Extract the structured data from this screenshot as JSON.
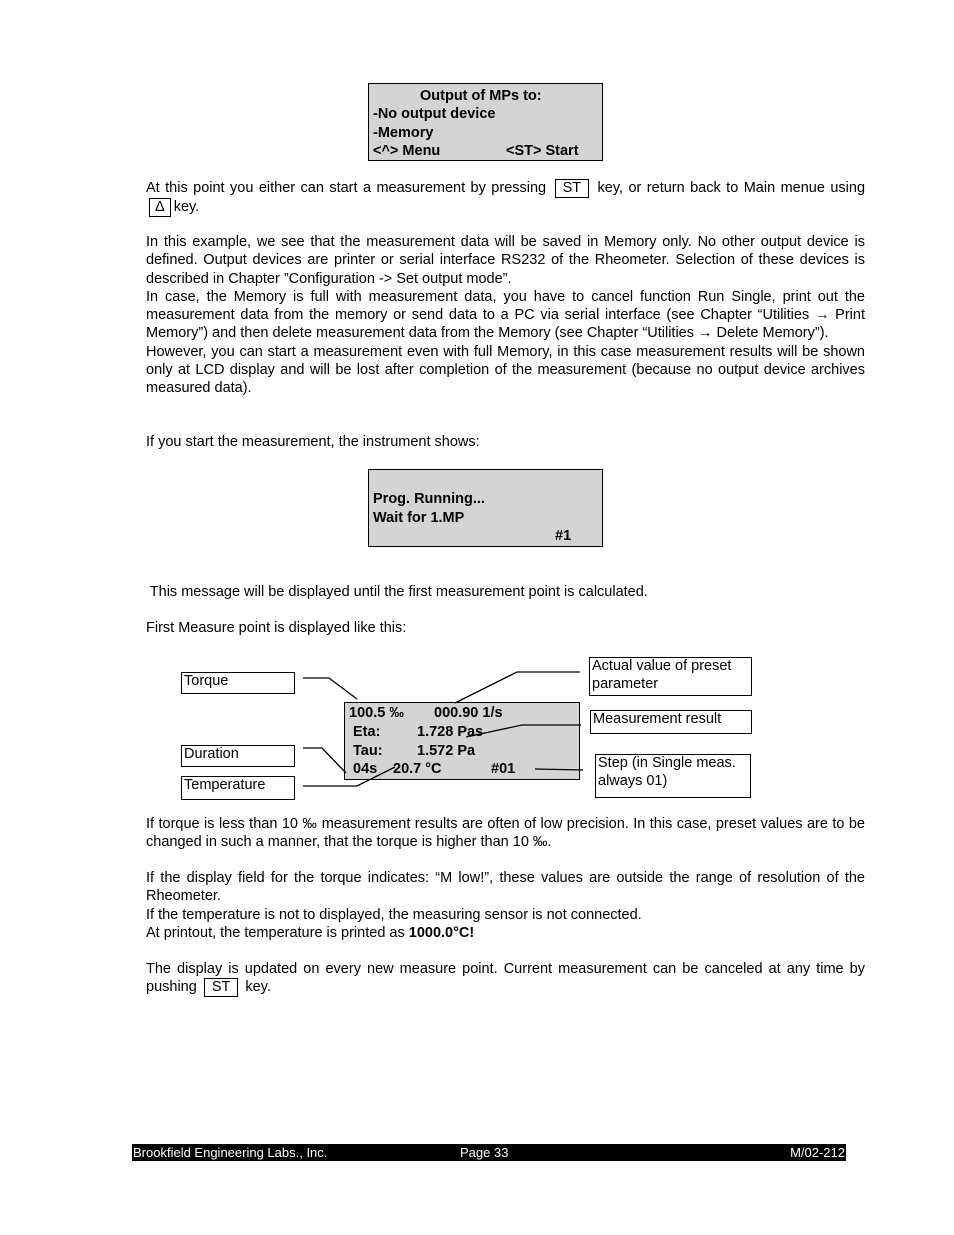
{
  "lcd_output": {
    "title": "Output of MPs to:",
    "line1": "-No output device",
    "line2": "-Memory",
    "menu_key": "<^> Menu",
    "start_key": "<ST> Start"
  },
  "para_keys": {
    "text_before_st": "At this point you either can start a measurement by pressing",
    "st_key": "ST",
    "text_after_st": "key, or return back to Main menue using",
    "up_key": "Δ",
    "text_after_up": "key."
  },
  "para_example": [
    "In this example, we see that the measurement data will be saved in Memory only. No other output device is defined. Output devices are printer or serial interface RS232 of the Rheometer. Selection of these devices is described in Chapter ”Configuration -> Set output mode”.",
    "In case, the Memory is full with measurement data, you have to cancel function Run Single, print out the measurement data from the memory or send data to a PC via serial interface (see Chapter “Utilities → Print Memory”) and then delete measurement data from the Memory (see Chapter “Utilities → Delete Memory”).",
    "However, you can start a measurement even with full Memory, in this case measurement results will be shown only at LCD display and will be lost after completion of the measurement (because no output device archives measured data)."
  ],
  "para_start": "If you start the measurement, the instrument shows:",
  "lcd_running": {
    "line1": "Prog. Running...",
    "line2": "Wait for 1.MP",
    "step": "#1"
  },
  "para_message": " This message will be displayed until the first measurement point is calculated.",
  "para_first": "First Measure point is displayed like this:",
  "lcd_measure": {
    "torque": "100.5 ‰",
    "rate": "000.90 1/s",
    "eta_label": "Eta:",
    "eta_value": "1.728 Pas",
    "tau_label": "Tau:",
    "tau_value": "1.572 Pa",
    "duration": "04s",
    "temperature": "20.7 °C",
    "step": "#01"
  },
  "callouts": {
    "torque": "Torque",
    "duration": "Duration",
    "temperature": "Temperature",
    "preset": "Actual value of preset parameter",
    "result": "Measurement result",
    "step": "Step (in Single meas. always 01)"
  },
  "para_torque": "If torque is less than 10 ‰ measurement results are often of low precision. In this case, preset values are to be changed in such a manner, that the torque is higher than 10 ‰.",
  "para_mlow": [
    "If the display field for the torque indicates: “M low!”, these values are outside the range of resolution of the Rheometer.",
    "If the temperature is not to displayed, the measuring sensor is not connected."
  ],
  "para_printout": {
    "text": "At printout, the temperature is printed as ",
    "bold": "1000.0°C!"
  },
  "para_update": {
    "text": "The display is updated on every new measure point. Current measurement can be canceled at any time by pushing",
    "st_key": "ST",
    "text_after": "key."
  },
  "footer": {
    "company": "Brookfield Engineering Labs., Inc.",
    "page": "Page 33",
    "doc_id": "M/02-212"
  }
}
